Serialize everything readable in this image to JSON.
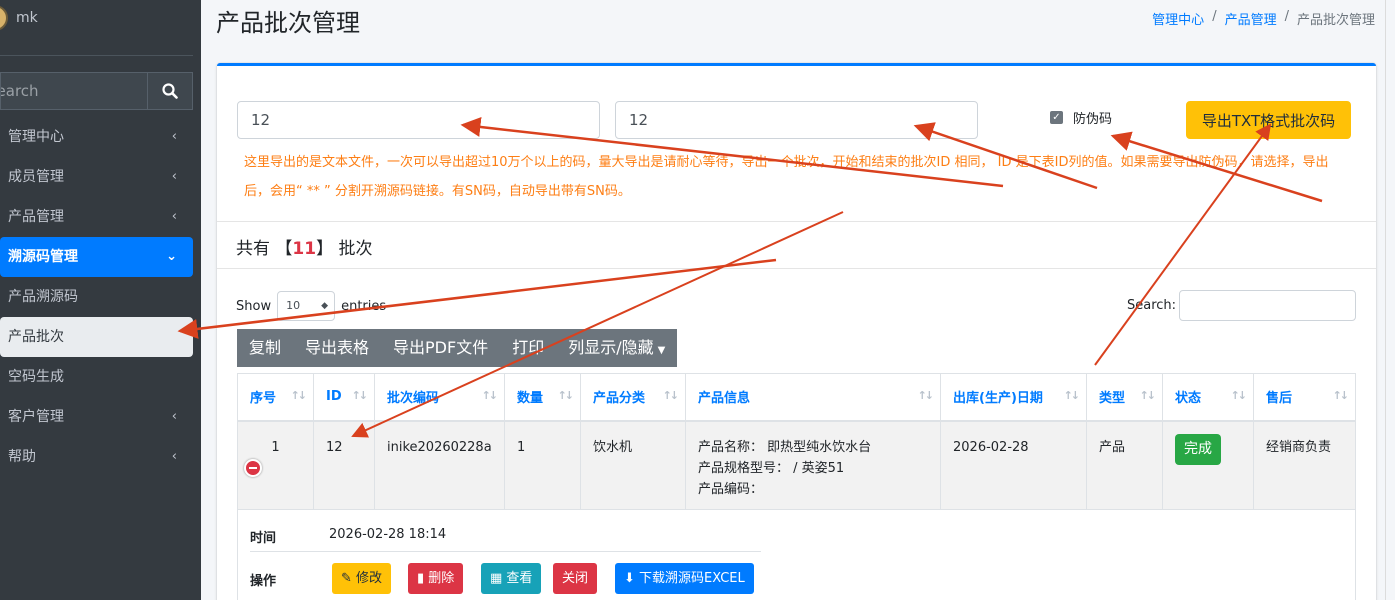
{
  "sidebar": {
    "user_name": "mk",
    "search_placeholder": "Search",
    "items": [
      {
        "label": "管理中心",
        "chevron": "‹"
      },
      {
        "label": "成员管理",
        "chevron": "‹"
      },
      {
        "label": "产品管理",
        "chevron": "‹"
      },
      {
        "label": "溯源码管理",
        "chevron": "⌄"
      },
      {
        "label": "产品溯源码"
      },
      {
        "label": "产品批次"
      },
      {
        "label": "空码生成"
      },
      {
        "label": "客户管理",
        "chevron": "‹"
      },
      {
        "label": "帮助",
        "chevron": "‹"
      }
    ]
  },
  "header": {
    "title": "产品批次管理",
    "breadcrumb": [
      "管理中心",
      "产品管理",
      "产品批次管理"
    ],
    "separator": "/"
  },
  "export": {
    "start_id": "12",
    "end_id": "12",
    "anti_fake_label": "防伪码",
    "anti_fake_checked": true,
    "button_label": "导出TXT格式批次码",
    "note": "这里导出的是文本文件，一次可以导出超过10万个以上的码，量大导出是请耐心等待，导出一个批次，开始和结束的批次ID 相同， ID 是下表ID列的值。如果需要导出防伪码，请选择，导出后，会用“ ** ” 分割开溯源码链接。有SN码，自动导出带有SN码。"
  },
  "summary": {
    "prefix": "共有",
    "lbracket": "【",
    "count": "11",
    "rbracket": "】",
    "suffix": "批次"
  },
  "datatable": {
    "show_label": "Show",
    "length_value": "10",
    "entries_label": "entries",
    "search_label": "Search:",
    "buttons": [
      "复制",
      "导出表格",
      "导出PDF文件",
      "打印",
      "列显示/隐藏"
    ],
    "columns": [
      "序号",
      "ID",
      "批次编码",
      "数量",
      "产品分类",
      "产品信息",
      "出库(生产)日期",
      "类型",
      "状态",
      "售后"
    ],
    "rows": [
      {
        "index": "1",
        "id": "12",
        "batch_code": "inike20260228a",
        "quantity": "1",
        "category": "饮水机",
        "info": [
          "产品名称： 即热型纯水饮水台",
          "产品规格型号： / 英姿51",
          "产品编码："
        ],
        "date": "2026-02-28",
        "type": "产品",
        "status": "完成",
        "after_sales": "经销商负责"
      }
    ],
    "child": {
      "time_label": "时间",
      "time_value": "2026-02-28 18:14",
      "actions_label": "操作",
      "actions": [
        "修改",
        "删除",
        "查看",
        "关闭",
        "下载溯源码EXCEL"
      ]
    }
  },
  "colors": {
    "sidebar_bg": "#343a40",
    "accent": "#007bff",
    "warning": "#ffc107",
    "danger": "#dc3545",
    "success": "#28a745",
    "info": "#17a2b8",
    "note_text": "#fd7e14",
    "annotation_arrow": "#d9411e"
  }
}
